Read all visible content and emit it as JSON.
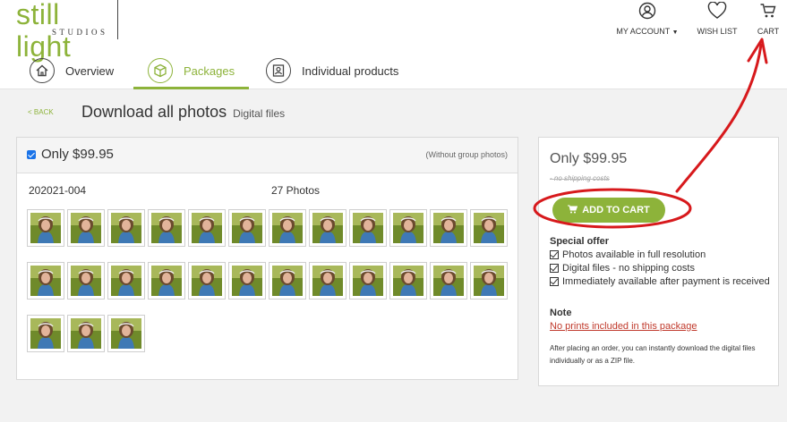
{
  "brand": {
    "name_top": "still light",
    "name_bottom": "STUDIOS",
    "color": "#8db33a"
  },
  "header": {
    "account_label": "MY ACCOUNT",
    "wishlist_label": "WISH LIST",
    "cart_label": "CART"
  },
  "tabs": [
    {
      "label": "Overview",
      "icon": "home-icon",
      "active": false
    },
    {
      "label": "Packages",
      "icon": "package-icon",
      "active": true
    },
    {
      "label": "Individual products",
      "icon": "portrait-icon",
      "active": false
    }
  ],
  "page": {
    "back_label": "< BACK",
    "title": "Download all photos",
    "subtitle": "Digital files"
  },
  "package": {
    "checked": true,
    "price_label": "Only $99.95",
    "note": "(Without group photos)",
    "code": "202021-004",
    "photo_count": "27 Photos",
    "thumbnail_rows": [
      12,
      12,
      3
    ]
  },
  "summary": {
    "price_label": "Only $99.95",
    "shipping": "- no shipping costs",
    "button_label": "ADD TO CART",
    "offer_title": "Special offer",
    "offer_items": [
      "Photos available in full resolution",
      "Digital files - no shipping costs",
      "Immediately available after payment is received"
    ],
    "note_title": "Note",
    "note_link": "No prints included in this package",
    "note_text": "After placing an order, you can instantly download the digital files individually or as a ZIP file."
  },
  "annotation_color": "#d7191c"
}
